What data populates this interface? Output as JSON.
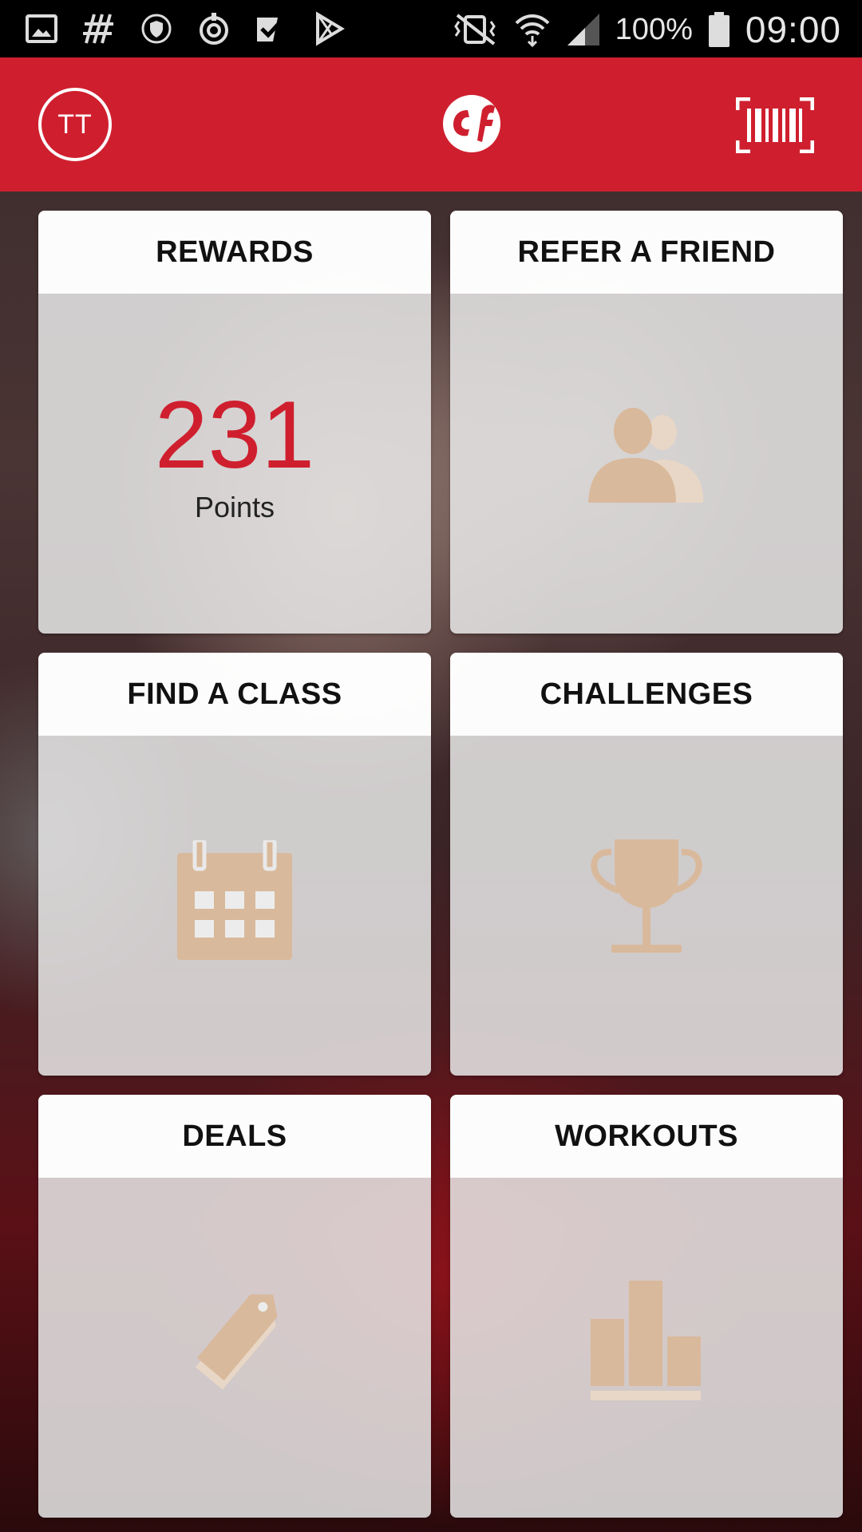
{
  "status_bar": {
    "battery": "100%",
    "time": "09:00",
    "icons": [
      "gallery-icon",
      "hashtag-icon",
      "shield-icon",
      "sync-icon",
      "checkbox-icon",
      "play-store-icon",
      "vibrate-icon",
      "wifi-icon",
      "signal-icon",
      "battery-icon"
    ]
  },
  "header": {
    "avatar_initials": "TT",
    "logo_icon": "crunch-logo-icon",
    "barcode_icon": "barcode-icon",
    "accent_color": "#cf1f2e"
  },
  "tiles": [
    {
      "title": "REWARDS",
      "value": "231",
      "value_label": "Points"
    },
    {
      "title": "REFER A FRIEND",
      "icon": "people-icon"
    },
    {
      "title": "FIND A CLASS",
      "icon": "calendar-icon"
    },
    {
      "title": "CHALLENGES",
      "icon": "trophy-icon"
    },
    {
      "title": "DEALS",
      "icon": "price-tag-icon"
    },
    {
      "title": "WORKOUTS",
      "icon": "bar-chart-icon"
    }
  ],
  "colors": {
    "icon_tan": "#d9b99b",
    "points_red": "#cf1f2e"
  }
}
